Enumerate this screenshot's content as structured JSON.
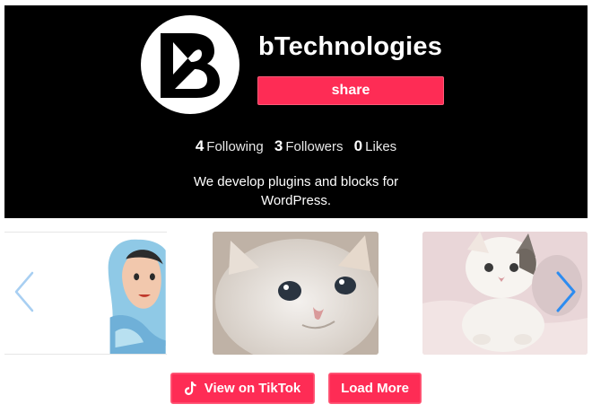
{
  "profile": {
    "username": "bTechnologies",
    "share_label": "share",
    "avatar_icon": "btechnologies-logo",
    "stats": {
      "following_count": "4",
      "following_label": "Following",
      "followers_count": "3",
      "followers_label": "Followers",
      "likes_count": "0",
      "likes_label": "Likes"
    },
    "bio": "We develop plugins and blocks for WordPress."
  },
  "carousel": {
    "prev_icon": "chevron-left-icon",
    "next_icon": "chevron-right-icon",
    "videos": [
      {
        "thumbnail": "hijab-girl-illustration"
      },
      {
        "thumbnail": "white-kitten-closeup"
      },
      {
        "thumbnail": "white-gray-kitten-on-blanket"
      }
    ]
  },
  "actions": {
    "view_on_tiktok": "View on TikTok",
    "load_more": "Load More"
  },
  "colors": {
    "accent": "#fe2c55",
    "header_bg": "#000000",
    "arrow": "#2d8cf0"
  }
}
